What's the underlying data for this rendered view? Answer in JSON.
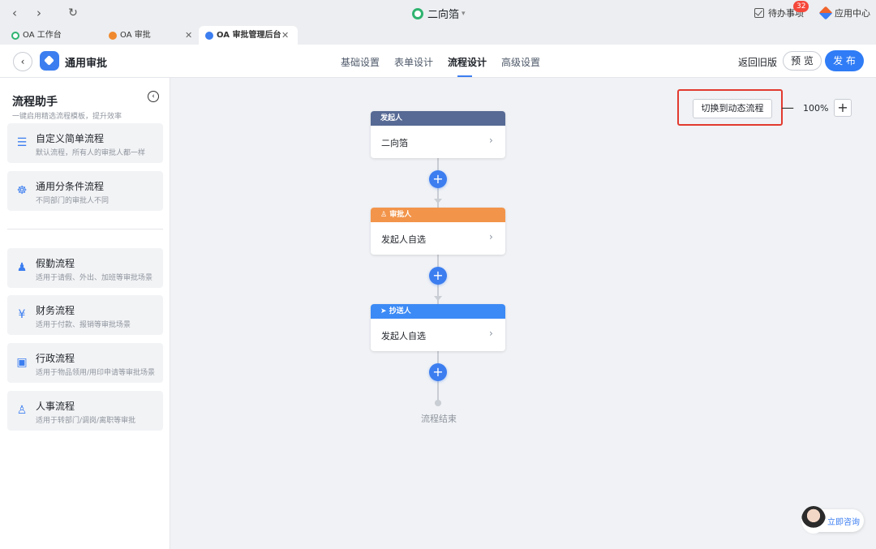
{
  "chrome": {
    "window_title": "二向箔",
    "todo_label": "待办事项",
    "todo_count": "32",
    "app_center": "应用中心"
  },
  "tabs": [
    {
      "label": "OA 工作台",
      "icon": "green-circle-icon",
      "color": "#2fb36f"
    },
    {
      "label": "OA 审批",
      "icon": "orange-circle-icon",
      "color": "#f0892d"
    },
    {
      "label": "OA 审批管理后台",
      "icon": "blue-circle-icon",
      "color": "#3c7ef0"
    }
  ],
  "appbar": {
    "name": "通用审批",
    "tabs": [
      "基础设置",
      "表单设计",
      "流程设计",
      "高级设置"
    ],
    "active_tab": "流程设计",
    "old_version": "返回旧版",
    "preview": "预 览",
    "publish": "发 布"
  },
  "sidebar": {
    "title": "流程助手",
    "subtitle": "一键启用精选流程模板，提升效率",
    "templates": [
      {
        "title": "自定义简单流程",
        "desc": "默认流程，所有人的审批人都一样",
        "icon": "list-icon"
      },
      {
        "title": "通用分条件流程",
        "desc": "不同部门的审批人不同",
        "icon": "branch-icon"
      },
      {
        "title": "假勤流程",
        "desc": "适用于请假、外出、加班等审批场景",
        "icon": "person-clock-icon"
      },
      {
        "title": "财务流程",
        "desc": "适用于付款、报销等审批场景",
        "icon": "yen-icon"
      },
      {
        "title": "行政流程",
        "desc": "适用于物品领用/用印申请等审批场景",
        "icon": "briefcase-icon"
      },
      {
        "title": "人事流程",
        "desc": "适用于转部门/调岗/离职等审批",
        "icon": "person-icon"
      }
    ]
  },
  "canvas": {
    "switch_label": "切换到动态流程",
    "zoom": "100%",
    "nodes": [
      {
        "header": "发起人",
        "body": "二向箔",
        "color": "#576a95"
      },
      {
        "header": "审批人",
        "body": "发起人自选",
        "color": "#f2944a"
      },
      {
        "header": "抄送人",
        "body": "发起人自选",
        "color": "#3c8af5"
      }
    ],
    "end_label": "流程结束"
  },
  "consult": "立即咨询"
}
